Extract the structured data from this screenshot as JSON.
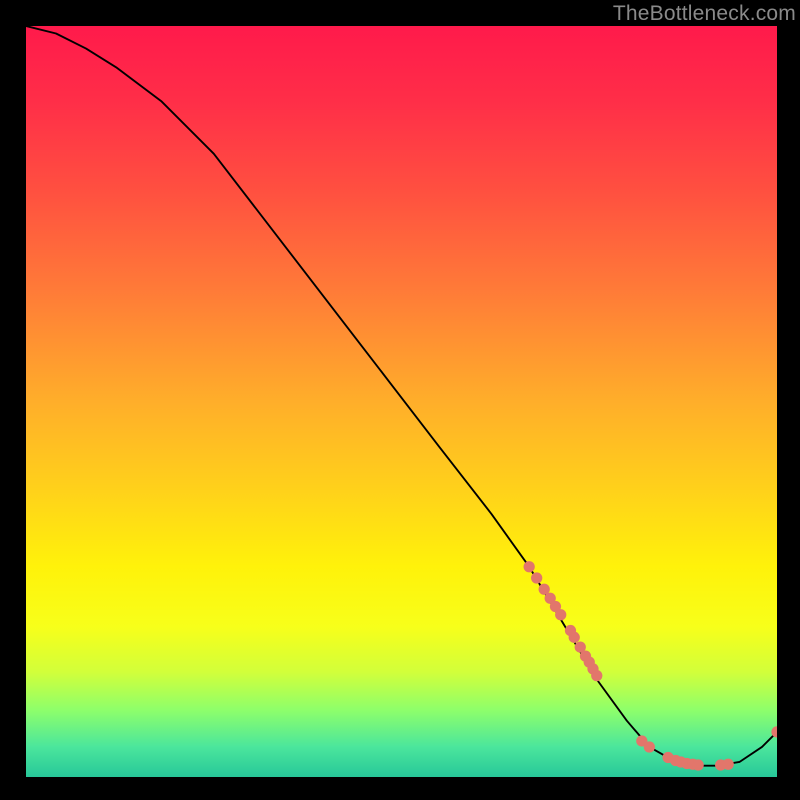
{
  "watermark": "TheBottleneck.com",
  "colors": {
    "marker": "#e2766b",
    "line": "#000000",
    "bg_black": "#000000"
  },
  "gradient_stops": [
    {
      "offset": 0.0,
      "color": "#ff1a4b"
    },
    {
      "offset": 0.1,
      "color": "#ff2e48"
    },
    {
      "offset": 0.22,
      "color": "#ff5040"
    },
    {
      "offset": 0.35,
      "color": "#ff7a38"
    },
    {
      "offset": 0.5,
      "color": "#ffae2a"
    },
    {
      "offset": 0.62,
      "color": "#ffd21a"
    },
    {
      "offset": 0.72,
      "color": "#fff20a"
    },
    {
      "offset": 0.8,
      "color": "#f7ff1a"
    },
    {
      "offset": 0.86,
      "color": "#d2ff3a"
    },
    {
      "offset": 0.91,
      "color": "#8fff6a"
    },
    {
      "offset": 0.96,
      "color": "#4be69c"
    },
    {
      "offset": 1.0,
      "color": "#27c799"
    }
  ],
  "chart_data": {
    "type": "line",
    "title": "",
    "xlabel": "",
    "ylabel": "",
    "xlim": [
      0,
      100
    ],
    "ylim": [
      0,
      100
    ],
    "grid": false,
    "series": [
      {
        "name": "bottleneck-curve",
        "x": [
          0,
          4,
          8,
          12,
          18,
          25,
          35,
          45,
          55,
          62,
          67,
          70,
          73,
          76,
          80,
          83,
          86,
          88,
          90,
          92,
          95,
          98,
          100
        ],
        "y": [
          100,
          99,
          97,
          94.5,
          90,
          83,
          70,
          57,
          44,
          35,
          28,
          23,
          18,
          13,
          7.5,
          4.0,
          2.3,
          1.7,
          1.5,
          1.5,
          2.0,
          4.0,
          6.0
        ]
      }
    ],
    "markers": [
      {
        "x": 67.0,
        "y": 28.0
      },
      {
        "x": 68.0,
        "y": 26.5
      },
      {
        "x": 69.0,
        "y": 25.0
      },
      {
        "x": 69.8,
        "y": 23.8
      },
      {
        "x": 70.5,
        "y": 22.7
      },
      {
        "x": 71.2,
        "y": 21.6
      },
      {
        "x": 72.5,
        "y": 19.5
      },
      {
        "x": 73.0,
        "y": 18.6
      },
      {
        "x": 73.8,
        "y": 17.3
      },
      {
        "x": 74.5,
        "y": 16.1
      },
      {
        "x": 75.0,
        "y": 15.3
      },
      {
        "x": 75.5,
        "y": 14.4
      },
      {
        "x": 76.0,
        "y": 13.5
      },
      {
        "x": 82.0,
        "y": 4.8
      },
      {
        "x": 83.0,
        "y": 4.0
      },
      {
        "x": 85.5,
        "y": 2.6
      },
      {
        "x": 86.5,
        "y": 2.2
      },
      {
        "x": 87.2,
        "y": 2.0
      },
      {
        "x": 88.0,
        "y": 1.8
      },
      {
        "x": 88.8,
        "y": 1.7
      },
      {
        "x": 89.5,
        "y": 1.6
      },
      {
        "x": 92.5,
        "y": 1.6
      },
      {
        "x": 93.5,
        "y": 1.7
      },
      {
        "x": 100.0,
        "y": 6.0
      }
    ]
  }
}
